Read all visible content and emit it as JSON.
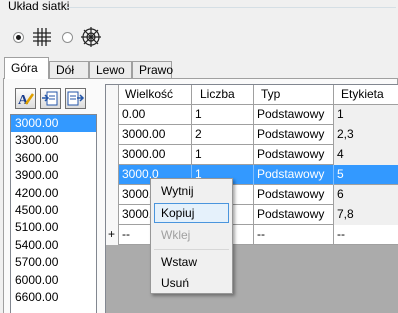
{
  "group": {
    "title": "Układ siatki"
  },
  "layout_options": [
    {
      "icon": "orthogonal-grid-icon",
      "selected": true
    },
    {
      "icon": "radial-grid-icon",
      "selected": false
    }
  ],
  "tabs": [
    {
      "label": "Góra",
      "active": true
    },
    {
      "label": "Dół",
      "active": false
    },
    {
      "label": "Lewo",
      "active": false
    },
    {
      "label": "Prawo",
      "active": false
    }
  ],
  "toolbar": {
    "buttons": [
      "edit-label-icon",
      "import-icon",
      "export-icon"
    ]
  },
  "values_list": {
    "items": [
      "3000.00",
      "3300.00",
      "3600.00",
      "3900.00",
      "4200.00",
      "4500.00",
      "5100.00",
      "5400.00",
      "5700.00",
      "6000.00",
      "6600.00"
    ],
    "selected_index": 0
  },
  "table": {
    "columns": [
      "Wielkość",
      "Liczba",
      "Typ",
      "Etykieta"
    ],
    "rows": [
      {
        "marker": "",
        "size": "0.00",
        "count": "1",
        "type": "Podstawowy",
        "label": "1"
      },
      {
        "marker": "",
        "size": "3000.00",
        "count": "2",
        "type": "Podstawowy",
        "label": "2,3"
      },
      {
        "marker": "",
        "size": "3000.00",
        "count": "1",
        "type": "Podstawowy",
        "label": "4"
      },
      {
        "marker": "",
        "size": "3000.0",
        "count": "1",
        "type": "Podstawowy",
        "label": "5"
      },
      {
        "marker": "",
        "size": "3000.",
        "count": "",
        "type": "Podstawowy",
        "label": "6"
      },
      {
        "marker": "",
        "size": "3000.",
        "count": "",
        "type": "Podstawowy",
        "label": "7,8"
      }
    ],
    "selected_row": 3,
    "new_row": {
      "marker": "+",
      "size": "--",
      "count": "",
      "type": "--",
      "label": "--"
    }
  },
  "context_menu": {
    "items": [
      {
        "label": "Wytnij",
        "state": "normal"
      },
      {
        "label": "Kopiuj",
        "state": "hover"
      },
      {
        "label": "Wklej",
        "state": "disabled"
      },
      {
        "label": "Wstaw",
        "state": "normal"
      },
      {
        "label": "Usuń",
        "state": "normal"
      }
    ]
  },
  "colors": {
    "selection": "#3399ff",
    "menu_hover": "#e5f1fb"
  }
}
